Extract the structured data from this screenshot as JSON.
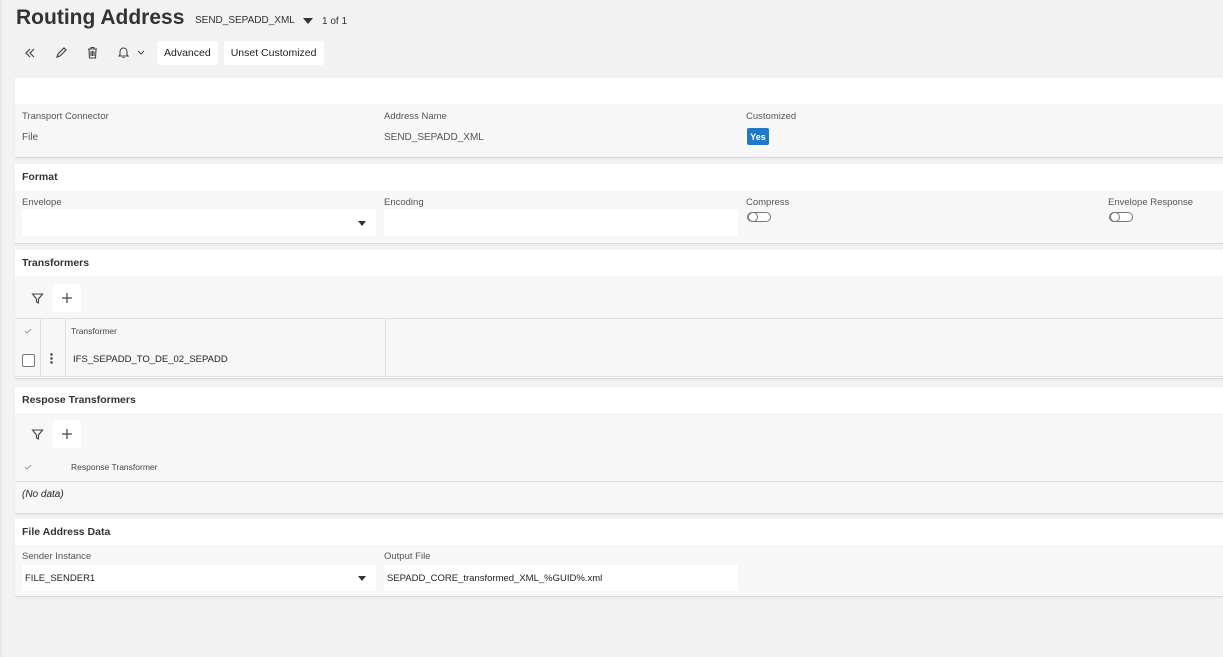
{
  "header": {
    "title": "Routing Address",
    "record_selector": "SEND_SEPADD_XML",
    "pager": "1 of 1"
  },
  "toolbar": {
    "advanced_label": "Advanced",
    "unset_label": "Unset Customized",
    "icons": [
      "double-chevron-left-icon",
      "pencil-icon",
      "trash-icon",
      "bell-icon",
      "chevron-down-icon"
    ]
  },
  "general": {
    "transport_connector_label": "Transport Connector",
    "transport_connector_value": "File",
    "address_name_label": "Address Name",
    "address_name_value": "SEND_SEPADD_XML",
    "customized_label": "Customized",
    "customized_value": "Yes"
  },
  "format": {
    "title": "Format",
    "envelope_label": "Envelope",
    "envelope_value": "",
    "encoding_label": "Encoding",
    "encoding_value": "",
    "compress_label": "Compress",
    "compress_on": false,
    "envelope_response_label": "Envelope Response",
    "envelope_response_on": false
  },
  "transformers": {
    "title": "Transformers",
    "column": "Transformer",
    "rows": [
      "IFS_SEPADD_TO_DE_02_SEPADD"
    ]
  },
  "response_transformers": {
    "title": "Respose Transformers",
    "column": "Response Transformer",
    "empty": "(No data)"
  },
  "file_address": {
    "title": "File Address Data",
    "sender_label": "Sender Instance",
    "sender_value": "FILE_SENDER1",
    "output_label": "Output File",
    "output_value": "SEPADD_CORE_transformed_XML_%GUID%.xml"
  },
  "colors": {
    "accent": "#1f78c8",
    "background": "#f2f2f2",
    "panel": "#f7f7f7"
  }
}
